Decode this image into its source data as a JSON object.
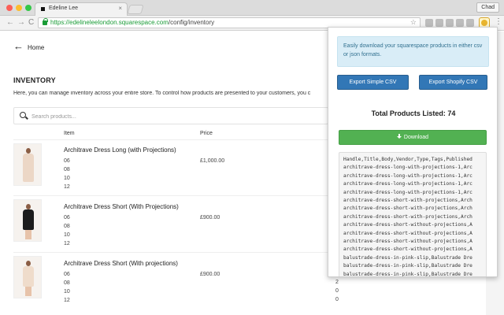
{
  "browser": {
    "tab_title": "Edeline Lee",
    "tab_close": "×",
    "user_label": "Chad",
    "url_host": "https://edelineleelondon.squarespace.com",
    "url_path": "/config/inventory",
    "back_glyph": "←",
    "forward_glyph": "→",
    "reload_glyph": "C",
    "star_glyph": "☆",
    "menu_glyph": "⋮"
  },
  "page": {
    "back_label": "Home",
    "title": "INVENTORY",
    "description": "Here, you can manage inventory across your entire store. To control how products are presented to your customers, you c",
    "search_placeholder": "Search products...",
    "columns": {
      "item": "Item",
      "price": "Price"
    },
    "products": [
      {
        "name": "Architrave Dress Long (with Projections)",
        "sizes": [
          "06",
          "08",
          "10",
          "12"
        ],
        "price": "£1,000.00",
        "qty": [],
        "color": "#ecd7c6"
      },
      {
        "name": "Architrave Dress Short (With Projections)",
        "sizes": [
          "06",
          "08",
          "10",
          "12"
        ],
        "price": "£900.00",
        "qty": [],
        "color": "#1c1c1c"
      },
      {
        "name": "Architrave Dress Short (With projections)",
        "sizes": [
          "06",
          "08",
          "10",
          "12"
        ],
        "price": "£900.00",
        "qty": [
          "2",
          "0",
          "0"
        ],
        "color": "#efdccb"
      }
    ]
  },
  "popup": {
    "notice": "Easily download your squarespace products in either csv or json formats.",
    "export_simple": "Export Simple CSV",
    "export_shopify": "Export Shopify CSV",
    "total_label": "Total Products Listed: 74",
    "download_label": "Download",
    "output_lines": [
      "Handle,Title,Body,Vendor,Type,Tags,Published",
      "architrave-dress-long-with-projections-1,Arc",
      "architrave-dress-long-with-projections-1,Arc",
      "architrave-dress-long-with-projections-1,Arc",
      "architrave-dress-long-with-projections-1,Arc",
      "architrave-dress-short-with-projections,Arch",
      "architrave-dress-short-with-projections,Arch",
      "architrave-dress-short-with-projections,Arch",
      "architrave-dress-short-without-projections,A",
      "architrave-dress-short-without-projections,A",
      "architrave-dress-short-without-projections,A",
      "architrave-dress-short-without-projections,A",
      "balustrade-dress-in-pink-slip,Balustrade Dre",
      "balustrade-dress-in-pink-slip,Balustrade Dre",
      "balustrade-dress-in-pink-slip,Balustrade Dre",
      "balustrade-dress-in-pink-slip,Balustrade Dre"
    ]
  },
  "colors": {
    "accent_blue": "#3277b6",
    "download_green": "#52b152",
    "notice_bg": "#d9edf7",
    "secure_green": "#1a9c37"
  }
}
